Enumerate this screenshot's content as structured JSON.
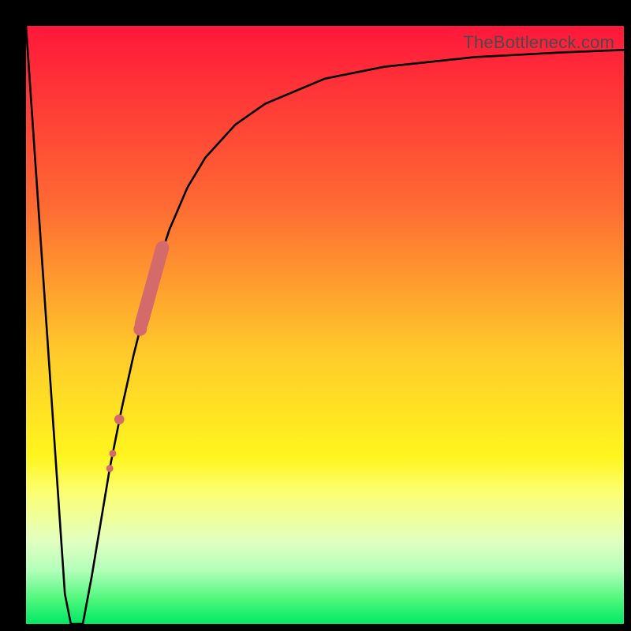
{
  "attribution": "TheBottleneck.com",
  "chart_data": {
    "type": "line",
    "title": "",
    "xlabel": "",
    "ylabel": "",
    "ylim": [
      0,
      100
    ],
    "xlim": [
      0,
      100
    ],
    "x": [
      0,
      6.5,
      7.5,
      8.5,
      9.5,
      11,
      12,
      13,
      14,
      16,
      18,
      20,
      22,
      24,
      27,
      30,
      35,
      40,
      50,
      60,
      75,
      90,
      100
    ],
    "values": [
      100,
      5,
      0,
      0,
      0,
      8,
      14,
      20,
      26,
      36,
      45,
      53,
      60,
      66,
      73,
      78,
      83.5,
      87,
      91.2,
      93.2,
      94.8,
      95.6,
      96
    ],
    "highlight_points": {
      "x": [
        14.0,
        14.5,
        15.6,
        19.1,
        23.0
      ],
      "y": [
        26,
        28.5,
        34.2,
        49.3,
        63.5
      ],
      "radius": [
        4.5,
        4.5,
        6.3,
        8.5,
        4.8
      ]
    },
    "highlight_segment": {
      "x0": 19.3,
      "y0": 50.2,
      "x1": 22.8,
      "y1": 62.9,
      "width": 17
    },
    "colors": {
      "curve": "#000000",
      "highlight": "#d46a6a"
    }
  }
}
